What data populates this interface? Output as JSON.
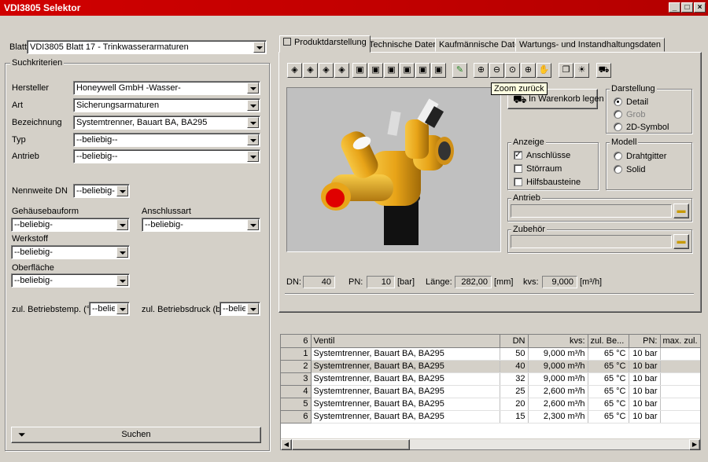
{
  "window": {
    "title": "VDI3805 Selektor"
  },
  "left": {
    "blatt_label": "Blatt",
    "blatt_value": "VDI3805 Blatt 17 - Trinkwasserarmaturen",
    "group_title": "Suchkriterien",
    "fields": [
      {
        "label": "Hersteller",
        "value": "Honeywell GmbH -Wasser-"
      },
      {
        "label": "Art",
        "value": "Sicherungsarmaturen"
      },
      {
        "label": "Bezeichnung",
        "value": "Systemtrenner, Bauart BA, BA295"
      },
      {
        "label": "Typ",
        "value": "--beliebig--"
      },
      {
        "label": "Antrieb",
        "value": "--beliebig--"
      }
    ],
    "nennweite_label": "Nennweite DN",
    "nennweite_value": "--beliebig-",
    "gehaeuse_label": "Gehäusebauform",
    "gehaeuse_value": "--beliebig-",
    "anschluss_label": "Anschlussart",
    "anschluss_value": "--beliebig-",
    "werkstoff_label": "Werkstoff",
    "werkstoff_value": "--beliebig-",
    "oberflaeche_label": "Oberfläche",
    "oberflaeche_value": "--beliebig-",
    "temp_label": "zul. Betriebstemp. (°C)",
    "temp_value": "--beliebi",
    "druck_label": "zul. Betriebsdruck (bar)",
    "druck_value": "--beliebi",
    "search_label": "Suchen"
  },
  "tabs": [
    {
      "label": "Produktdarstellung"
    },
    {
      "label": "Technische Daten"
    },
    {
      "label": "Kaufmännische Daten"
    },
    {
      "label": "Wartungs- und Instandhaltungsdaten"
    }
  ],
  "tooltip": "Zoom zurück",
  "cart_button": "In Warenkorb legen",
  "darstellung": {
    "title": "Darstellung",
    "options": [
      "Detail",
      "Grob",
      "2D-Symbol"
    ],
    "selected": 0
  },
  "anzeige": {
    "title": "Anzeige",
    "options": [
      "Anschlüsse",
      "Störraum",
      "Hilfsbausteine"
    ],
    "checked": [
      true,
      false,
      false
    ]
  },
  "modell": {
    "title": "Modell",
    "options": [
      "Drahtgitter",
      "Solid"
    ]
  },
  "antrieb_title": "Antrieb",
  "zubehoer_title": "Zubehör",
  "specs": {
    "dn_label": "DN:",
    "dn_value": "40",
    "pn_label": "PN:",
    "pn_value": "10",
    "pn_unit": "[bar]",
    "laenge_label": "Länge:",
    "laenge_value": "282,00",
    "laenge_unit": "[mm]",
    "kvs_label": "kvs:",
    "kvs_value": "9,000",
    "kvs_unit": "[m³/h]"
  },
  "table": {
    "count": "6",
    "headers": [
      "Ventil",
      "DN",
      "kvs:",
      "zul. Be...",
      "PN:",
      "max. zul. ..."
    ],
    "rows": [
      {
        "i": "1",
        "ventil": "Systemtrenner, Bauart BA, BA295",
        "dn": "50",
        "kvs": "9,000 m³/h",
        "temp": "65 °C",
        "pn": "10 bar"
      },
      {
        "i": "2",
        "ventil": "Systemtrenner, Bauart BA, BA295",
        "dn": "40",
        "kvs": "9,000 m³/h",
        "temp": "65 °C",
        "pn": "10 bar"
      },
      {
        "i": "3",
        "ventil": "Systemtrenner, Bauart BA, BA295",
        "dn": "32",
        "kvs": "9,000 m³/h",
        "temp": "65 °C",
        "pn": "10 bar"
      },
      {
        "i": "4",
        "ventil": "Systemtrenner, Bauart BA, BA295",
        "dn": "25",
        "kvs": "2,600 m³/h",
        "temp": "65 °C",
        "pn": "10 bar"
      },
      {
        "i": "5",
        "ventil": "Systemtrenner, Bauart BA, BA295",
        "dn": "20",
        "kvs": "2,600 m³/h",
        "temp": "65 °C",
        "pn": "10 bar"
      },
      {
        "i": "6",
        "ventil": "Systemtrenner, Bauart BA, BA295",
        "dn": "15",
        "kvs": "2,300 m³/h",
        "temp": "65 °C",
        "pn": "10 bar"
      }
    ],
    "selected_row": 1
  }
}
